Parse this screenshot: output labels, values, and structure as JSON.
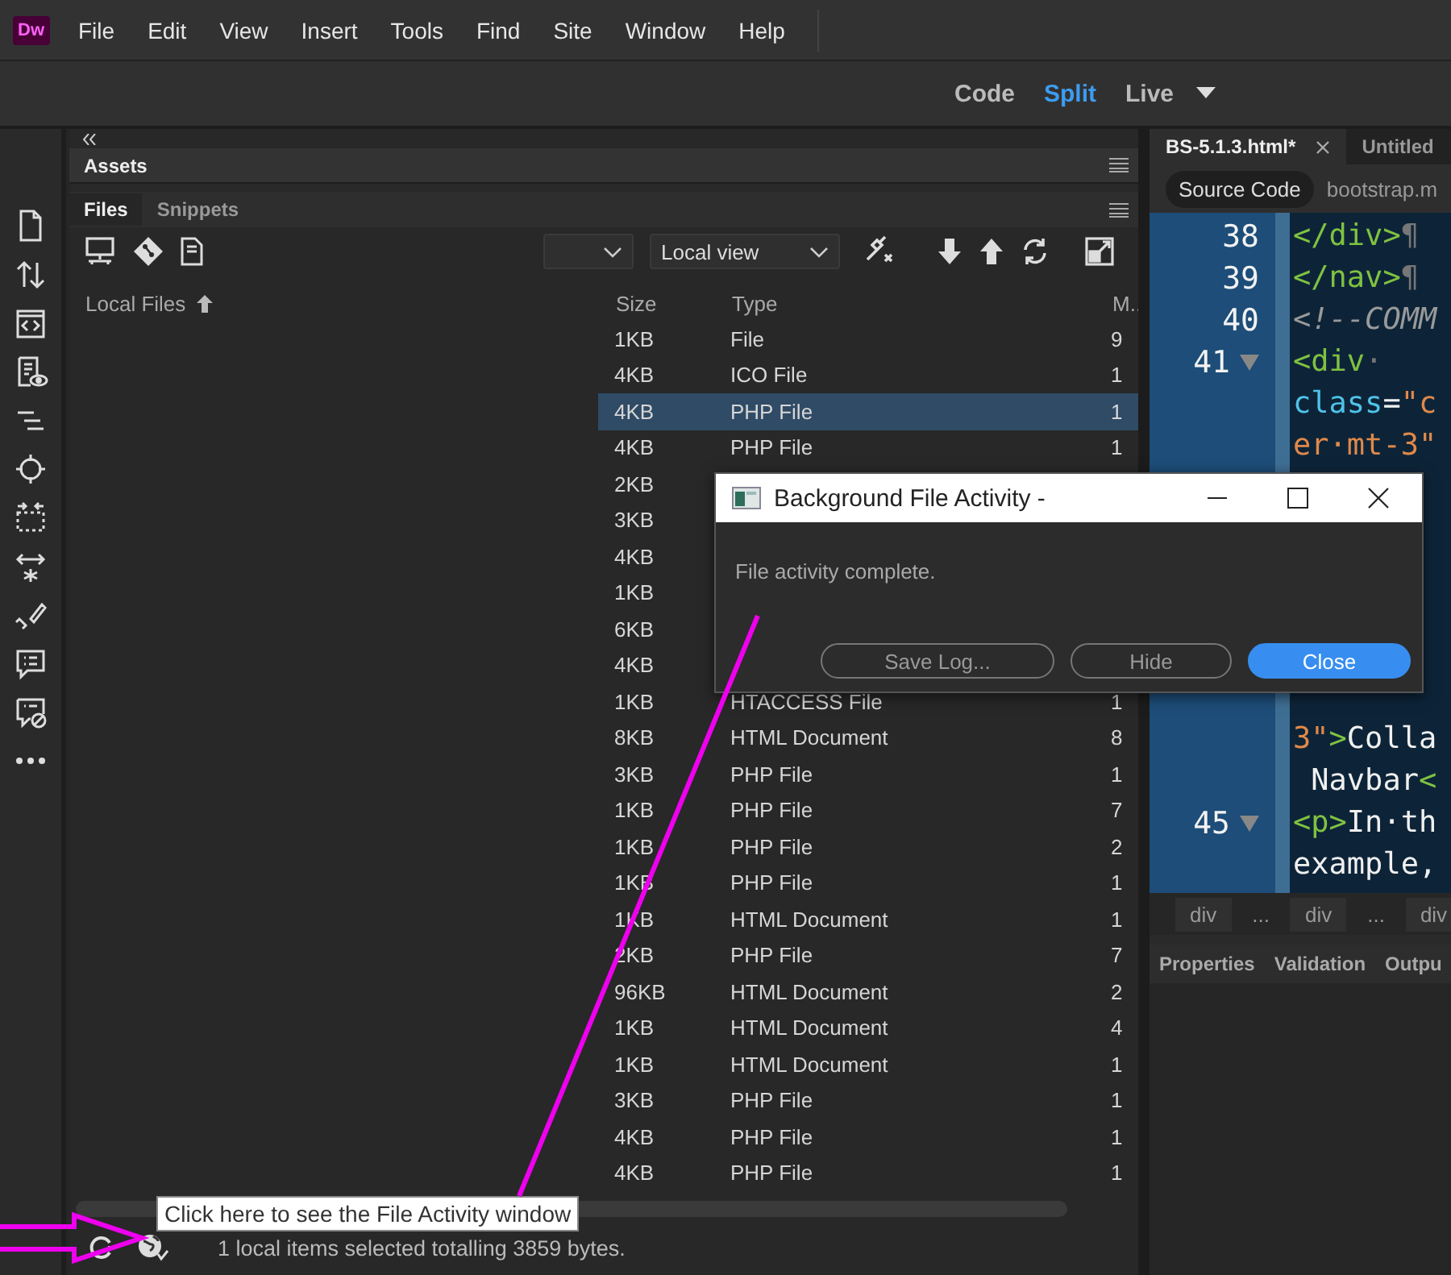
{
  "app": {
    "logo": "Dw"
  },
  "menu": [
    "File",
    "Edit",
    "View",
    "Insert",
    "Tools",
    "Find",
    "Site",
    "Window",
    "Help"
  ],
  "view_modes": [
    {
      "label": "Code",
      "selected": false
    },
    {
      "label": "Split",
      "selected": true
    },
    {
      "label": "Live",
      "selected": false
    }
  ],
  "files_panel": {
    "assets_title": "Assets",
    "tabs": [
      {
        "label": "Files",
        "selected": true
      },
      {
        "label": "Snippets",
        "selected": false
      }
    ],
    "view_select": "Local view",
    "columns": [
      "Local Files",
      "Size",
      "Type",
      "M.."
    ],
    "rows": [
      {
        "size": "1KB",
        "type": "File",
        "column_4": "9",
        "selected": false
      },
      {
        "size": "4KB",
        "type": "ICO File",
        "column_4": "1",
        "selected": false
      },
      {
        "size": "4KB",
        "type": "PHP File",
        "column_4": "1",
        "selected": true
      },
      {
        "size": "4KB",
        "type": "PHP File",
        "column_4": "1",
        "selected": false
      },
      {
        "size": "2KB",
        "selected": false
      },
      {
        "size": "3KB",
        "selected": false
      },
      {
        "size": "4KB",
        "selected": false
      },
      {
        "size": "1KB",
        "selected": false
      },
      {
        "size": "6KB",
        "selected": false
      },
      {
        "size": "4KB",
        "selected": false
      },
      {
        "size": "1KB",
        "type": "HTACCESS File",
        "column_4": "1",
        "selected": false
      },
      {
        "size": "8KB",
        "type": "HTML Document",
        "column_4": "8",
        "selected": false
      },
      {
        "size": "3KB",
        "type": "PHP File",
        "column_4": "1",
        "selected": false
      },
      {
        "size": "1KB",
        "type": "PHP File",
        "column_4": "7",
        "selected": false
      },
      {
        "size": "1KB",
        "type": "PHP File",
        "column_4": "2",
        "selected": false
      },
      {
        "size": "1KB",
        "type": "PHP File",
        "column_4": "1",
        "selected": false
      },
      {
        "size": "1KB",
        "type": "HTML Document",
        "column_4": "1",
        "selected": false
      },
      {
        "size": "2KB",
        "type": "PHP File",
        "column_4": "7",
        "selected": false
      },
      {
        "size": "96KB",
        "type": "HTML Document",
        "column_4": "2",
        "selected": false
      },
      {
        "size": "1KB",
        "type": "HTML Document",
        "column_4": "4",
        "selected": false
      },
      {
        "size": "1KB",
        "type": "HTML Document",
        "column_4": "1",
        "selected": false
      },
      {
        "size": "3KB",
        "type": "PHP File",
        "column_4": "1",
        "selected": false
      },
      {
        "size": "4KB",
        "type": "PHP File",
        "column_4": "1",
        "selected": false
      },
      {
        "size": "4KB",
        "type": "PHP File",
        "column_4": "1",
        "selected": false
      }
    ],
    "status": "1 local items selected totalling 3859 bytes.",
    "tooltip": "Click here to see the File Activity window"
  },
  "document": {
    "tabs": [
      {
        "label": "BS-5.1.3.html*",
        "selected": true,
        "closable": true
      },
      {
        "label": "Untitled",
        "selected": false,
        "closable": false
      }
    ],
    "related_files": [
      {
        "label": "Source Code",
        "selected": true
      },
      {
        "label": "bootstrap.m",
        "selected": false
      }
    ],
    "code_top": [
      {
        "number": "38",
        "fold": false,
        "tokens": [
          {
            "kind": "tag",
            "text": "</div>"
          },
          {
            "kind": "mark",
            "text": "¶"
          }
        ]
      },
      {
        "number": "39",
        "fold": false,
        "tokens": [
          {
            "kind": "tag",
            "text": "</nav>"
          },
          {
            "kind": "mark",
            "text": "¶"
          }
        ]
      },
      {
        "number": "40",
        "fold": false,
        "tokens": [
          {
            "kind": "comment",
            "text": "<!--COMM"
          }
        ]
      },
      {
        "number": "41",
        "fold": true,
        "tokens": [
          {
            "kind": "tag",
            "text": "<div"
          },
          {
            "kind": "mark",
            "text": "·"
          }
        ]
      },
      {
        "tokens": [
          {
            "kind": "attr",
            "text": "class"
          },
          {
            "kind": "text",
            "text": "="
          },
          {
            "kind": "string",
            "text": "\"c"
          }
        ]
      },
      {
        "tokens": [
          {
            "kind": "string",
            "text": "er·mt-3\""
          }
        ]
      }
    ],
    "code_bottom": [
      {
        "tokens": [
          {
            "kind": "string",
            "text": "3\""
          },
          {
            "kind": "tag",
            "text": ">"
          },
          {
            "kind": "text",
            "text": "Colla"
          }
        ]
      },
      {
        "tokens": [
          {
            "kind": "text",
            "text": " Navbar"
          },
          {
            "kind": "tag",
            "text": "<"
          }
        ]
      },
      {
        "number": "45",
        "fold": true,
        "tokens": [
          {
            "kind": "tag",
            "text": "<p>"
          },
          {
            "kind": "text",
            "text": "In·th"
          }
        ]
      },
      {
        "tokens": [
          {
            "kind": "text",
            "text": "example,"
          }
        ]
      }
    ],
    "breadcrumbs": [
      "div",
      "...",
      "div",
      "...",
      "div"
    ],
    "panel_tabs": [
      "Properties",
      "Validation",
      "Outpu"
    ]
  },
  "dialog": {
    "title": "Background File Activity -",
    "message": "File activity complete.",
    "buttons": [
      {
        "label": "Save Log...",
        "primary": false
      },
      {
        "label": "Hide",
        "primary": false
      },
      {
        "label": "Close",
        "primary": true
      }
    ]
  }
}
